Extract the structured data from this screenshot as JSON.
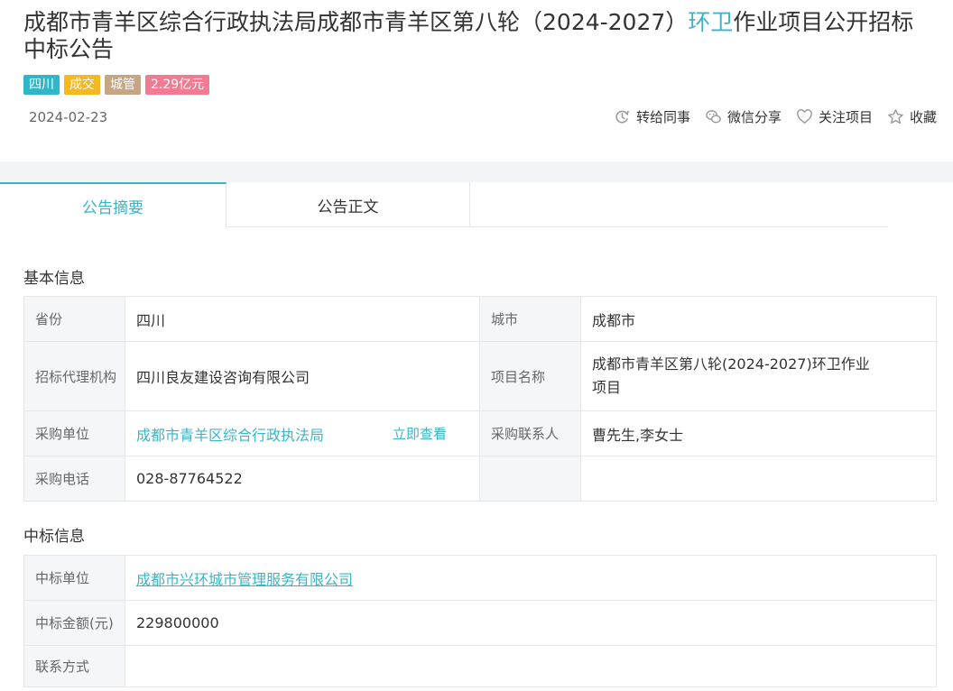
{
  "title": {
    "part1": "成都市青羊区综合行政执法局成都市青羊区第八轮（2024-2027）",
    "highlight": "环卫",
    "part2": "作业项目公开招标中标公告"
  },
  "tags": [
    {
      "label": "四川",
      "color": "#2fb6c8"
    },
    {
      "label": "成交",
      "color": "#f5b820"
    },
    {
      "label": "城管",
      "color": "#c7a583"
    },
    {
      "label": "2.29亿元",
      "color": "#f27b92"
    }
  ],
  "date": "2024-02-23",
  "actions": {
    "forward": "转给同事",
    "wechat": "微信分享",
    "follow": "关注项目",
    "favorite": "收藏"
  },
  "tabs": [
    {
      "label": "公告摘要"
    },
    {
      "label": "公告正文"
    }
  ],
  "basic": {
    "heading": "基本信息",
    "province_label": "省份",
    "province": "四川",
    "city_label": "城市",
    "city": "成都市",
    "agency_label": "招标代理机构",
    "agency": "四川良友建设咨询有限公司",
    "project_label": "项目名称",
    "project": "成都市青羊区第八轮(2024-2027)环卫作业项目",
    "buyer_label": "采购单位",
    "buyer": "成都市青羊区综合行政执法局",
    "view_now": "立即查看",
    "contact_label": "采购联系人",
    "contact": "曹先生,李女士",
    "phone_label": "采购电话",
    "phone": "028-87764522"
  },
  "award": {
    "heading": "中标信息",
    "winner_label": "中标单位",
    "winner": "成都市兴环城市管理服务有限公司",
    "amount_label": "中标金额(元)",
    "amount": "229800000",
    "contact_label": "联系方式",
    "contact": ""
  }
}
